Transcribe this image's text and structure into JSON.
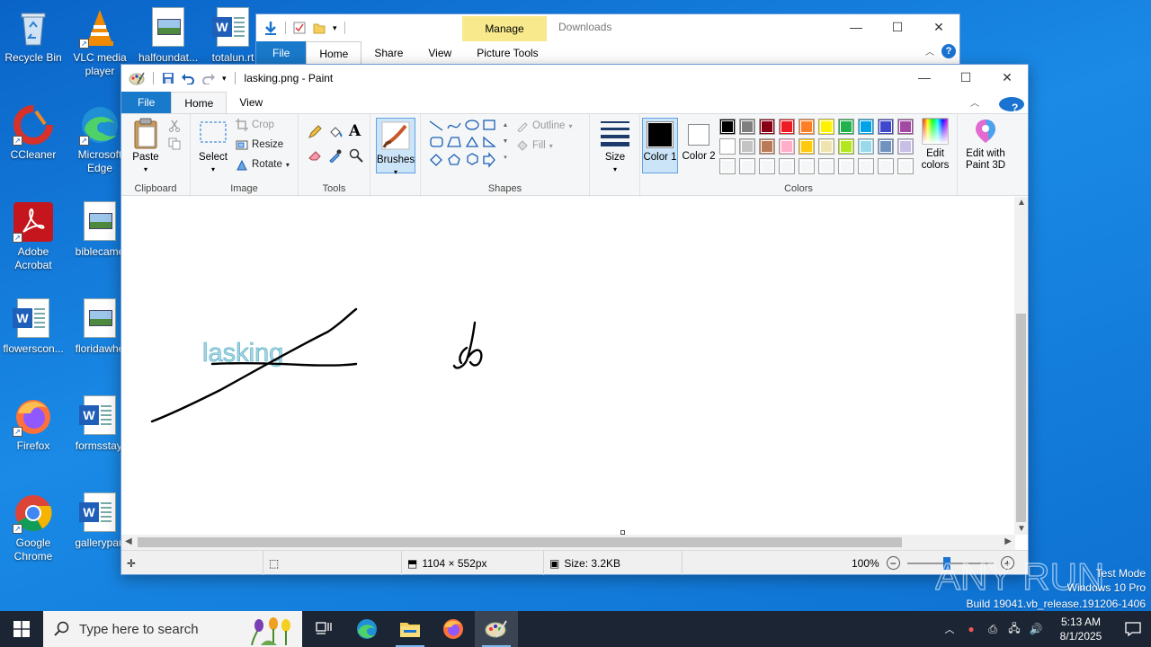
{
  "desktop": {
    "icons": [
      {
        "label": "Recycle Bin",
        "icon": "recycle-bin-icon"
      },
      {
        "label": "VLC media player",
        "icon": "vlc-icon"
      },
      {
        "label": "halfoundat...",
        "icon": "image-file-icon"
      },
      {
        "label": "totalun.rt",
        "icon": "word-doc-icon"
      },
      {
        "label": "CCleaner",
        "icon": "ccleaner-icon"
      },
      {
        "label": "Microsoft Edge",
        "icon": "edge-icon"
      },
      {
        "label": "Adobe Acrobat",
        "icon": "acrobat-icon"
      },
      {
        "label": "biblecame",
        "icon": "image-file-icon"
      },
      {
        "label": "flowerscon...",
        "icon": "word-doc-icon"
      },
      {
        "label": "floridawhe",
        "icon": "image-file-icon"
      },
      {
        "label": "Firefox",
        "icon": "firefox-icon"
      },
      {
        "label": "formsstay.",
        "icon": "word-doc-icon"
      },
      {
        "label": "Google Chrome",
        "icon": "chrome-icon"
      },
      {
        "label": "gallerypau",
        "icon": "word-doc-icon"
      }
    ]
  },
  "explorer": {
    "title": "Downloads",
    "manage_label": "Manage",
    "tabs": [
      "File",
      "Home",
      "Share",
      "View",
      "Picture Tools"
    ]
  },
  "paint": {
    "title": "lasking.png - Paint",
    "tabs": [
      "File",
      "Home",
      "View"
    ],
    "ribbon": {
      "clipboard": {
        "label": "Clipboard",
        "paste": "Paste"
      },
      "image": {
        "label": "Image",
        "select": "Select",
        "crop": "Crop",
        "resize": "Resize",
        "rotate": "Rotate"
      },
      "tools": {
        "label": "Tools"
      },
      "brushes": "Brushes",
      "shapes": {
        "label": "Shapes",
        "outline": "Outline",
        "fill": "Fill"
      },
      "size": "Size",
      "colors": {
        "label": "Colors",
        "color1": "Color 1",
        "color2": "Color 2",
        "edit_colors": "Edit colors",
        "color1_value": "#000000",
        "color2_value": "#ffffff",
        "palette_row1": [
          "#000000",
          "#7f7f7f",
          "#880015",
          "#ed1c24",
          "#ff7f27",
          "#fff200",
          "#22b14c",
          "#00a2e8",
          "#3f48cc",
          "#a349a4"
        ],
        "palette_row2": [
          "#ffffff",
          "#c3c3c3",
          "#b97a57",
          "#ffaec9",
          "#ffc90e",
          "#efe4b0",
          "#b5e61d",
          "#99d9ea",
          "#7092be",
          "#c8bfe7"
        ]
      },
      "paint3d": "Edit with Paint 3D"
    },
    "canvas": {
      "text": "lasking"
    },
    "status": {
      "dimensions": "1104 × 552px",
      "size": "Size: 3.2KB",
      "zoom": "100%"
    }
  },
  "watermark": {
    "line1": "Test Mode",
    "line2": "Windows 10 Pro",
    "line3": "Build 19041.vb_release.191206-1406",
    "brand": "ANY RUN"
  },
  "taskbar": {
    "search_placeholder": "Type here to search",
    "time": "5:13 AM",
    "date": "8/1/2025"
  }
}
